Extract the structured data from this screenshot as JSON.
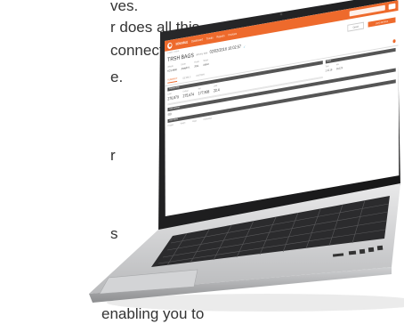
{
  "background_text": {
    "line1": "ves.",
    "line2": "r does all this",
    "line3": "connected to",
    "line4": "e.",
    "line5": "r",
    "line6": "s",
    "line7": "enabling you to"
  },
  "app": {
    "brand": "SENSIBLE",
    "nav_items": [
      "Dashboard",
      "Trucks",
      "Reports",
      "Invoices"
    ],
    "title": "TRSH BAGS",
    "title_sub": "delivery date",
    "title_id": "02/02/2016 10:02:57",
    "check_mark": "✓",
    "btn_secondary": "Cancel",
    "btn_primary": "LOAD DETAILS",
    "breadcrumb": "Loads > Active",
    "meta": [
      {
        "label": "Vehicle",
        "value": "KCS 8960"
      },
      {
        "label": "Driver",
        "value": "Joseph K."
      },
      {
        "label": "Route",
        "value": "2041"
      },
      {
        "label": "Status",
        "value": "Active"
      }
    ],
    "tabs": [
      "SUMMARY",
      "DETAILS",
      "HISTORY"
    ],
    "section_left": "Shipment Info",
    "section_right": "Notes",
    "stats": [
      {
        "label": "Load",
        "value": "276,879"
      },
      {
        "label": "Unload",
        "value": "275,674"
      },
      {
        "label": "Net",
        "value": "177,908"
      },
      {
        "label": "Units",
        "value": "22.4"
      }
    ],
    "right_stats": [
      {
        "label": "Total",
        "value": "1:12.18"
      },
      {
        "label": "Min",
        "value": "10,123"
      }
    ],
    "section_mid": "Load summary",
    "section_bottom": "Load details",
    "foot": [
      "Product",
      "Weight",
      "Origin",
      "Destination"
    ]
  }
}
